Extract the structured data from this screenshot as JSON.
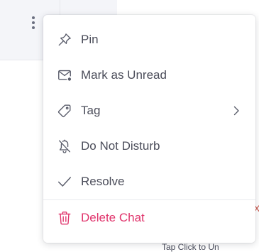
{
  "background": {
    "more_options_icon": "vertical-ellipsis-icon",
    "partial_text": "Tap Click to Un",
    "partial_mark": "X"
  },
  "menu": {
    "items": [
      {
        "label": "Pin",
        "icon": "pin-icon"
      },
      {
        "label": "Mark as Unread",
        "icon": "mail-unread-icon"
      },
      {
        "label": "Tag",
        "icon": "tag-icon",
        "submenu": true
      },
      {
        "label": "Do Not Disturb",
        "icon": "bell-off-icon"
      },
      {
        "label": "Resolve",
        "icon": "check-icon"
      }
    ],
    "danger_item": {
      "label": "Delete Chat",
      "icon": "trash-icon"
    }
  },
  "colors": {
    "text": "#4b4d5a",
    "icon": "#5a5d6b",
    "danger": "#e0336b"
  }
}
